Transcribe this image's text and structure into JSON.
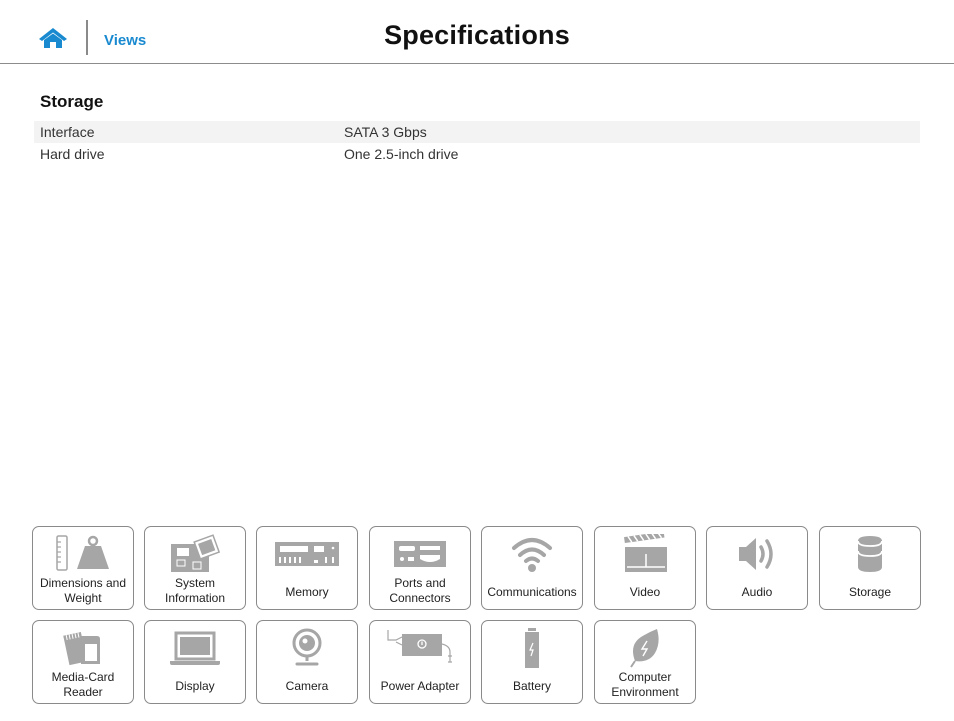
{
  "header": {
    "home_icon": "home-icon",
    "nav_link": "Views",
    "title": "Specifications"
  },
  "section": {
    "title": "Storage",
    "rows": [
      {
        "label": "Interface",
        "value": "SATA 3 Gbps"
      },
      {
        "label": "Hard drive",
        "value": "One 2.5-inch drive"
      }
    ]
  },
  "tiles": [
    {
      "label": "Dimensions and Weight",
      "line1": "Dimensions and",
      "line2": "Weight",
      "icon": "weight-ruler-icon"
    },
    {
      "label": "System Information",
      "line1": "System",
      "line2": "Information",
      "icon": "motherboard-icon"
    },
    {
      "label": "Memory",
      "line1": "Memory",
      "line2": "",
      "icon": "memory-module-icon"
    },
    {
      "label": "Ports and Connectors",
      "line1": "Ports and",
      "line2": "Connectors",
      "icon": "ports-icon"
    },
    {
      "label": "Communications",
      "line1": "Communications",
      "line2": "",
      "icon": "wifi-icon"
    },
    {
      "label": "Video",
      "line1": "Video",
      "line2": "",
      "icon": "clapperboard-icon"
    },
    {
      "label": "Audio",
      "line1": "Audio",
      "line2": "",
      "icon": "speaker-icon"
    },
    {
      "label": "Storage",
      "line1": "Storage",
      "line2": "",
      "icon": "storage-cylinder-icon"
    },
    {
      "label": "Media-Card Reader",
      "line1": "Media-Card",
      "line2": "Reader",
      "icon": "memory-card-icon"
    },
    {
      "label": "Display",
      "line1": "Display",
      "line2": "",
      "icon": "laptop-display-icon"
    },
    {
      "label": "Camera",
      "line1": "Camera",
      "line2": "",
      "icon": "webcam-icon"
    },
    {
      "label": "Power Adapter",
      "line1": "Power Adapter",
      "line2": "",
      "icon": "power-adapter-icon"
    },
    {
      "label": "Battery",
      "line1": "Battery",
      "line2": "",
      "icon": "battery-icon"
    },
    {
      "label": "Computer Environment",
      "line1": "Computer",
      "line2": "Environment",
      "icon": "leaf-icon"
    }
  ],
  "colors": {
    "accent": "#1a8ad0",
    "icon_gray": "#a6a6a6",
    "row_stripe": "#f3f3f3",
    "tile_border": "#8a8a8a"
  }
}
